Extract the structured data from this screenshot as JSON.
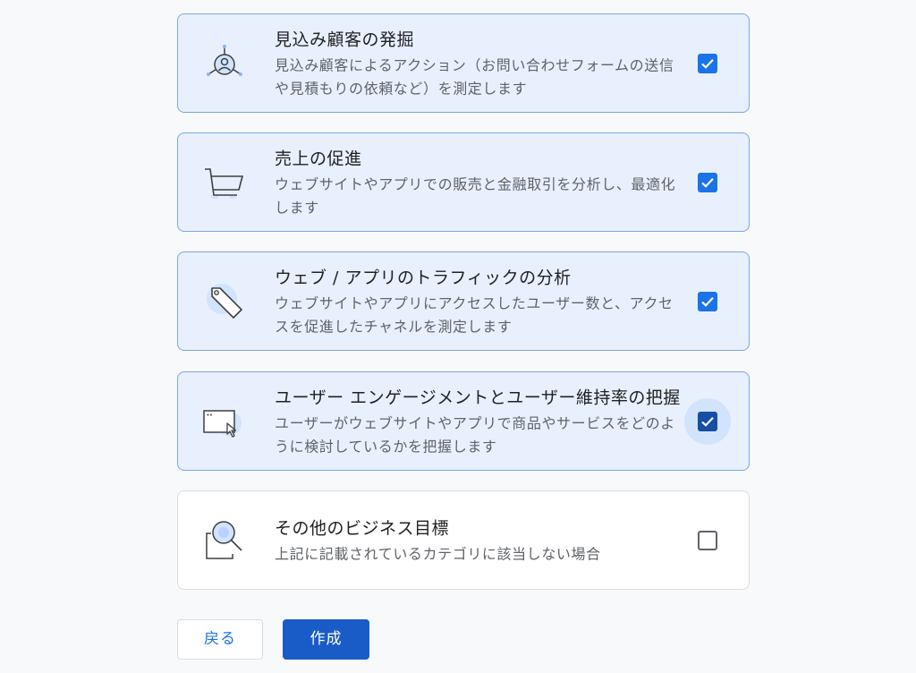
{
  "goals": [
    {
      "title": "見込み顧客の発掘",
      "description": "見込み顧客によるアクション（お問い合わせフォームの送信や見積もりの依頼など）を測定します",
      "icon": "lead-person-icon",
      "checked": true
    },
    {
      "title": "売上の促進",
      "description": "ウェブサイトやアプリでの販売と金融取引を分析し、最適化します",
      "icon": "shopping-cart-icon",
      "checked": true
    },
    {
      "title": "ウェブ / アプリのトラフィックの分析",
      "description": "ウェブサイトやアプリにアクセスしたユーザー数と、アクセスを促進したチャネルを測定します",
      "icon": "price-tag-icon",
      "checked": true
    },
    {
      "title": "ユーザー エンゲージメントとユーザー維持率の把握",
      "description": "ユーザーがウェブサイトやアプリで商品やサービスをどのように検討しているかを把握します",
      "icon": "browser-window-cursor-icon",
      "checked": true
    },
    {
      "title": "その他のビジネス目標",
      "description": "上記に記載されているカテゴリに該当しない場合",
      "icon": "magnifier-icon",
      "checked": false
    }
  ],
  "buttons": {
    "back_label": "戻る",
    "create_label": "作成"
  },
  "colors": {
    "accent": "#1a73e8",
    "selected_card_bg": "#e8f0fe",
    "selected_card_border": "#7aa7e0",
    "primary_button": "#1a5cc7"
  }
}
